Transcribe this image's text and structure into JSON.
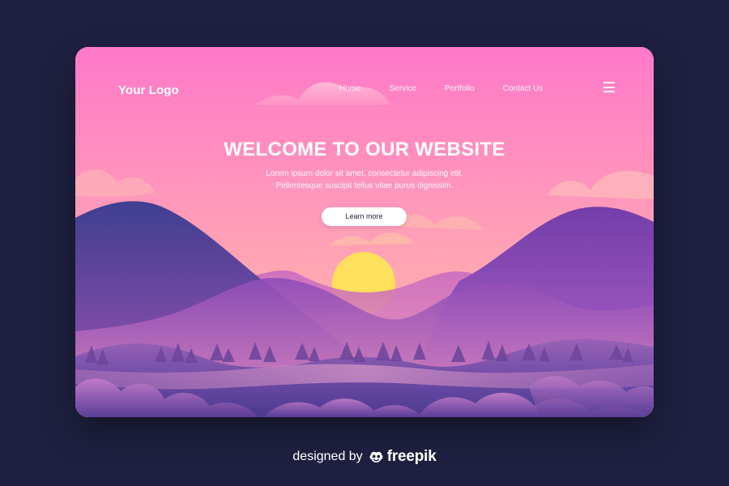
{
  "header": {
    "logo": "Your Logo",
    "nav_items": [
      {
        "label": "Home"
      },
      {
        "label": "Service"
      },
      {
        "label": "Portfolio"
      },
      {
        "label": "Contact Us"
      }
    ],
    "menu_icon": "hamburger-menu-icon"
  },
  "hero": {
    "title": "WELCOME TO OUR WEBSITE",
    "subtitle_lines": [
      "Lorem ipsum dolor sit amet, consectetur adipiscing elit.",
      "Pellentesque suscipit tellus vitae purus dignissim."
    ],
    "button_label": "Learn more"
  },
  "footer": {
    "credit_text": "designed by",
    "credit_brand": "freepik",
    "brand_icon": "freepik-icon"
  },
  "colors": {
    "page_background": "#1f2040",
    "sky_top": "#ff78c9",
    "sky_bottom": "#ffc1a0",
    "sun": "#ffe05c",
    "mountain_dark": "#463b8d",
    "mountain_purple": "#8a4bc0",
    "ground": "#6f4ca0",
    "button_background": "#ffffff",
    "text_light": "#ffffff"
  }
}
